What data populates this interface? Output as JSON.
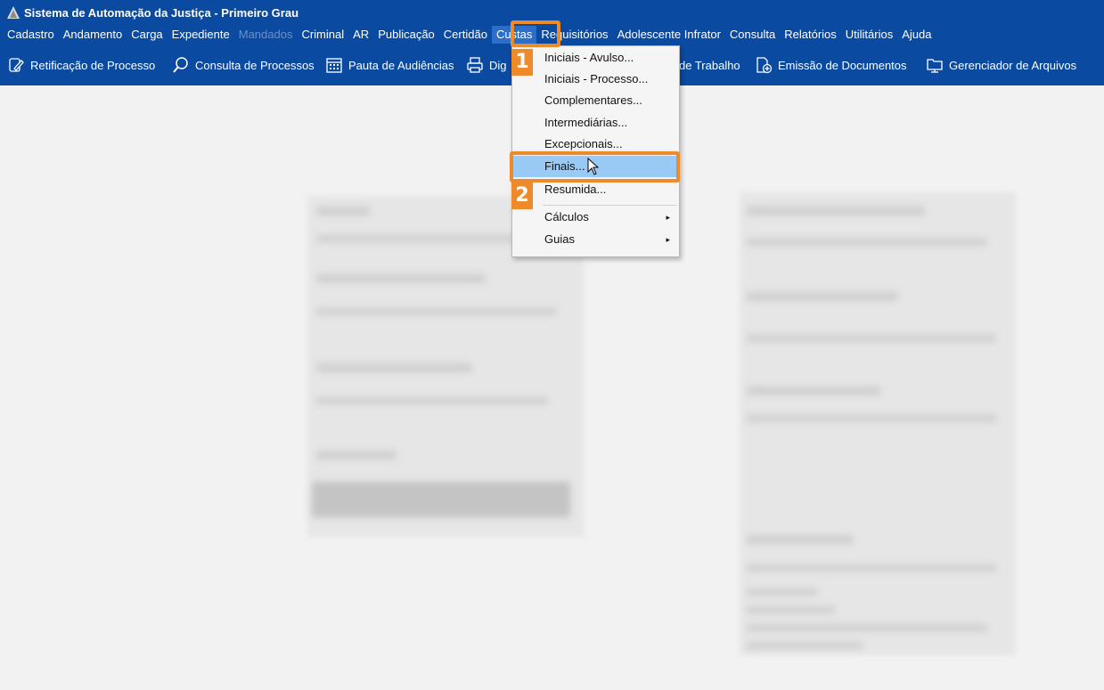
{
  "window": {
    "title": "Sistema de Automação da Justiça - Primeiro Grau",
    "app_icon": "saj-logo-icon"
  },
  "menubar": {
    "items": [
      {
        "label": "Cadastro",
        "disabled": false
      },
      {
        "label": "Andamento",
        "disabled": false
      },
      {
        "label": "Carga",
        "disabled": false
      },
      {
        "label": "Expediente",
        "disabled": false
      },
      {
        "label": "Mandados",
        "disabled": true
      },
      {
        "label": "Criminal",
        "disabled": false
      },
      {
        "label": "AR",
        "disabled": false
      },
      {
        "label": "Publicação",
        "disabled": false
      },
      {
        "label": "Certidão",
        "disabled": false
      },
      {
        "label": "Custas",
        "disabled": false,
        "active": true
      },
      {
        "label": "Requisitórios",
        "disabled": false
      },
      {
        "label": "Adolescente Infrator",
        "disabled": false
      },
      {
        "label": "Consulta",
        "disabled": false
      },
      {
        "label": "Relatórios",
        "disabled": false
      },
      {
        "label": "Utilitários",
        "disabled": false
      },
      {
        "label": "Ajuda",
        "disabled": false
      }
    ]
  },
  "toolbar": {
    "items": [
      {
        "label": "Retificação de Processo",
        "icon": "pencil-icon"
      },
      {
        "label": "Consulta de Processos",
        "icon": "search-icon"
      },
      {
        "label": "Pauta de Audiências",
        "icon": "calendar-icon"
      },
      {
        "label": "Dig",
        "icon": "printer-icon"
      },
      {
        "label": "de Trabalho",
        "icon": ""
      },
      {
        "label": "Emissão de Documentos",
        "icon": "document-add-icon"
      },
      {
        "label": "Gerenciador de Arquivos",
        "icon": "folder-screen-icon"
      }
    ]
  },
  "custas_menu": {
    "items": [
      {
        "label": "Iniciais - Avulso...",
        "submenu": false
      },
      {
        "label": "Iniciais - Processo...",
        "submenu": false
      },
      {
        "label": "Complementares...",
        "submenu": false
      },
      {
        "label": "Intermediárias...",
        "submenu": false
      },
      {
        "label": "Excepcionais...",
        "submenu": false
      },
      {
        "label": "Finais...",
        "submenu": false,
        "highlighted": true
      },
      {
        "label": "Resumida...",
        "submenu": false
      },
      {
        "label": "Cálculos",
        "submenu": true
      },
      {
        "label": "Guias",
        "submenu": true
      }
    ],
    "submenu_arrow": "▸"
  },
  "callouts": [
    {
      "number": "1",
      "target": "Custas"
    },
    {
      "number": "2",
      "target": "Finais..."
    }
  ],
  "colors": {
    "accent": "#0a4aa0",
    "highlight": "#99c9f5",
    "callout": "#ef8a2a"
  }
}
